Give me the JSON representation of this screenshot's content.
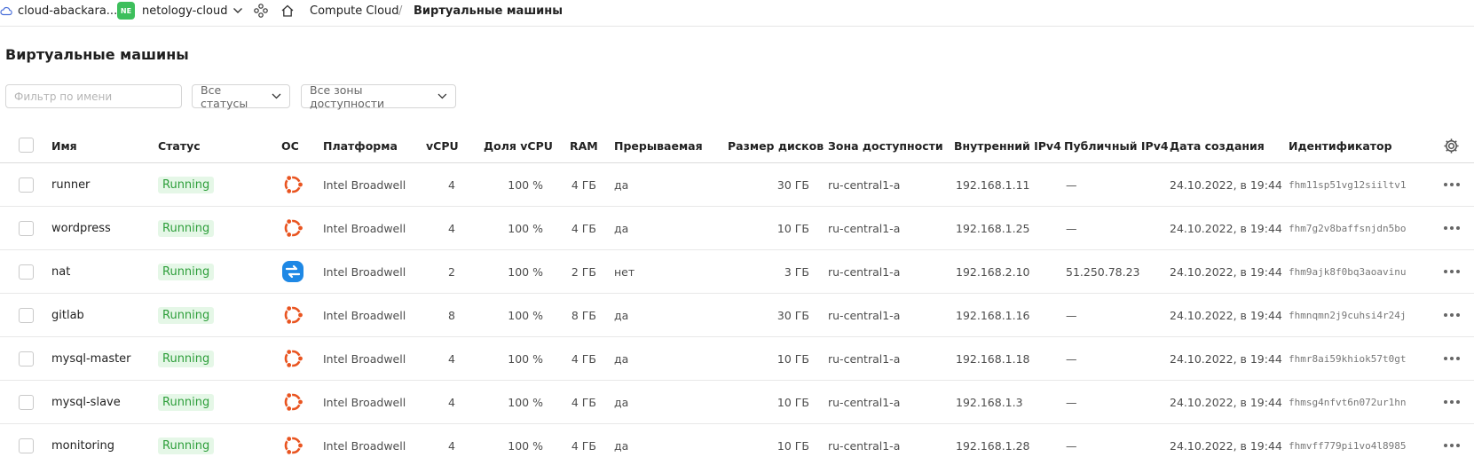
{
  "header": {
    "cloud_name": "cloud-abackara...",
    "folder_badge": "NE",
    "folder_name": "netology-cloud",
    "service": "Compute Cloud",
    "separator": "/",
    "current_page": "Виртуальные машины"
  },
  "page_title": "Виртуальные машины",
  "filters": {
    "name_placeholder": "Фильтр по имени",
    "status_value": "Все статусы",
    "zone_value": "Все зоны доступности"
  },
  "columns": {
    "name": "Имя",
    "status": "Статус",
    "os": "ОС",
    "platform": "Платформа",
    "vcpu": "vCPU",
    "vcpu_share": "Доля vCPU",
    "ram": "RAM",
    "preemptible": "Прерываемая",
    "disk_size": "Размер дисков",
    "zone": "Зона доступности",
    "internal_ip": "Внутренний IPv4",
    "public_ip": "Публичный IPv4",
    "created": "Дата создания",
    "id": "Идентификатор"
  },
  "rows": [
    {
      "name": "runner",
      "status": "Running",
      "os": "ubuntu",
      "platform": "Intel Broadwell",
      "vcpu": "4",
      "vcpu_share": "100 %",
      "ram": "4 ГБ",
      "preemptible": "да",
      "disk_size": "30 ГБ",
      "zone": "ru-central1-a",
      "internal_ip": "192.168.1.11",
      "public_ip": "—",
      "created": "24.10.2022, в 19:44",
      "id": "fhm11sp51vg12siiltv1"
    },
    {
      "name": "wordpress",
      "status": "Running",
      "os": "ubuntu",
      "platform": "Intel Broadwell",
      "vcpu": "4",
      "vcpu_share": "100 %",
      "ram": "4 ГБ",
      "preemptible": "да",
      "disk_size": "10 ГБ",
      "zone": "ru-central1-a",
      "internal_ip": "192.168.1.25",
      "public_ip": "—",
      "created": "24.10.2022, в 19:44",
      "id": "fhm7g2v8baffsnjdn5bo"
    },
    {
      "name": "nat",
      "status": "Running",
      "os": "nat",
      "platform": "Intel Broadwell",
      "vcpu": "2",
      "vcpu_share": "100 %",
      "ram": "2 ГБ",
      "preemptible": "нет",
      "disk_size": "3 ГБ",
      "zone": "ru-central1-a",
      "internal_ip": "192.168.2.10",
      "public_ip": "51.250.78.23",
      "created": "24.10.2022, в 19:44",
      "id": "fhm9ajk8f0bq3aoavinu"
    },
    {
      "name": "gitlab",
      "status": "Running",
      "os": "ubuntu",
      "platform": "Intel Broadwell",
      "vcpu": "8",
      "vcpu_share": "100 %",
      "ram": "8 ГБ",
      "preemptible": "да",
      "disk_size": "30 ГБ",
      "zone": "ru-central1-a",
      "internal_ip": "192.168.1.16",
      "public_ip": "—",
      "created": "24.10.2022, в 19:44",
      "id": "fhmnqmn2j9cuhsi4r24j"
    },
    {
      "name": "mysql-master",
      "status": "Running",
      "os": "ubuntu",
      "platform": "Intel Broadwell",
      "vcpu": "4",
      "vcpu_share": "100 %",
      "ram": "4 ГБ",
      "preemptible": "да",
      "disk_size": "10 ГБ",
      "zone": "ru-central1-a",
      "internal_ip": "192.168.1.18",
      "public_ip": "—",
      "created": "24.10.2022, в 19:44",
      "id": "fhmr8ai59khiok57t0gt"
    },
    {
      "name": "mysql-slave",
      "status": "Running",
      "os": "ubuntu",
      "platform": "Intel Broadwell",
      "vcpu": "4",
      "vcpu_share": "100 %",
      "ram": "4 ГБ",
      "preemptible": "да",
      "disk_size": "10 ГБ",
      "zone": "ru-central1-a",
      "internal_ip": "192.168.1.3",
      "public_ip": "—",
      "created": "24.10.2022, в 19:44",
      "id": "fhmsg4nfvt6n072ur1hn"
    },
    {
      "name": "monitoring",
      "status": "Running",
      "os": "ubuntu",
      "platform": "Intel Broadwell",
      "vcpu": "4",
      "vcpu_share": "100 %",
      "ram": "4 ГБ",
      "preemptible": "да",
      "disk_size": "10 ГБ",
      "zone": "ru-central1-a",
      "internal_ip": "192.168.1.28",
      "public_ip": "—",
      "created": "24.10.2022, в 19:44",
      "id": "fhmvff779pi1vo4l8985"
    }
  ],
  "colors": {
    "running_bg": "#e5f7e7",
    "running_text": "#2d9e3a",
    "ubuntu": "#e95420",
    "nat": "#1e88e5"
  }
}
